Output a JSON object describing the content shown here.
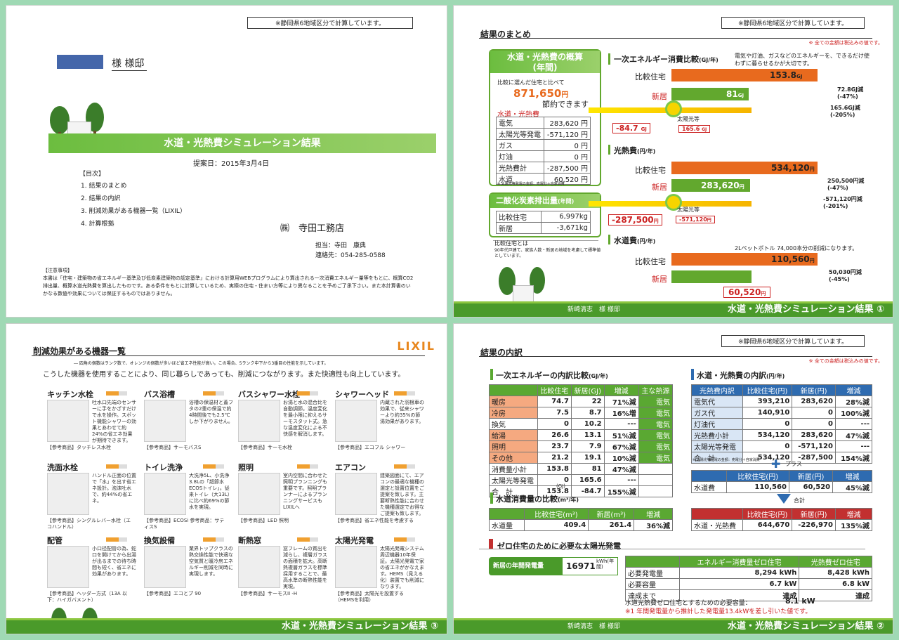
{
  "p1": {
    "note": "※静岡県6地域区分で計算しています。",
    "customer": "様 様邸",
    "banner": "水道・光熱費シミュレーション結果",
    "date": "提案日：2015年3月4日",
    "toc_title": "【目次】",
    "toc": [
      "1. 結果のまとめ",
      "2. 結果の内訳",
      "3. 削減効果がある機器一覧（LIXIL）",
      "4. 計算根拠"
    ],
    "company": "㈱　寺田工務店",
    "staff": "担当：寺田　康典",
    "contact": "連絡先：054-285-0588",
    "caution_title": "【注意事項】",
    "caution": "本書は「住宅・建築物の省エネルギー基準及び低炭素建築物の認定基準」における計算用WEBプログラムにより算出される一次消費エネルギー量等をもとに、概算CO2排出量、概算水道光熱費を算出したものです。ある条件をもとに計算しているため、実際の住宅・住まい方等により異なることを予めご了承下さい。また本計算書のいかなる数値や効果については保証するものではありません。"
  },
  "p2": {
    "note": "※静岡県6地域区分で計算しています。",
    "tax_note": "※ 全ての金額は税込みの値です。",
    "title": "結果のまとめ",
    "overview_title": "水道・光熱費の概算",
    "overview_sub": "(年間)",
    "compare_text": "比較に選んだ住宅と比べて",
    "saving": "871,650",
    "yen": "円",
    "saving_text": "節約できます",
    "cost_title": "水道・光熱費",
    "cost_rows": [
      [
        "電気",
        "283,620 円"
      ],
      [
        "太陽光等発電",
        "-571,120 円"
      ],
      [
        "ガス",
        "0 円"
      ],
      [
        "灯油",
        "0 円"
      ],
      [
        "光熱費計",
        "-287,500 円"
      ],
      [
        "水道",
        "60,520 円"
      ]
    ],
    "cost_note": "※ 太陽光等発電の金額：売電分＋自家消費",
    "co2_title": "二酸化炭素排出量",
    "co2_unit": "(年間)",
    "co2_rows": [
      [
        "比較住宅",
        "6,997kg"
      ],
      [
        "新居",
        "-3,671kg"
      ]
    ],
    "compare_house_title": "比較住宅とは",
    "compare_house_text": "90年代戸建て、家族人数・新居の地域を考慮して標準値としています。",
    "energy_title": "一次エネルギー消費比較",
    "energy_unit": "(GJ/年)",
    "energy_desc": "電気や灯油、ガスなどのエネルギーを、できるだけ使わずに暮らせるかが大切です。",
    "label_compare": "比較住宅",
    "label_new": "新居",
    "energy_compare": "153.8",
    "energy_new": "81",
    "gj": "GJ",
    "energy_diff1": "72.8GJ減",
    "energy_diff1_pct": "(-47%)",
    "energy_diff2": "165.6GJ減",
    "energy_diff2_pct": "(-205%)",
    "energy_net": "-84.7",
    "solar_label": "太陽光等",
    "solar_energy": "165.6",
    "utility_title": "光熱費",
    "utility_unit": "(円/年)",
    "utility_compare": "534,120",
    "utility_new": "283,620",
    "utility_diff1": "250,500円減",
    "utility_diff1_pct": "(-47%)",
    "utility_diff2": "-571,120円減",
    "utility_diff2_pct": "(-201%)",
    "utility_net": "-287,500",
    "solar_utility": "-571,120",
    "water_title": "水道費",
    "water_unit": "(円/年)",
    "water_desc": "2Lペットボトル 74,000本分の削減になります。",
    "water_compare": "110,560",
    "water_new": "60,520",
    "water_diff": "50,030円減",
    "water_diff_pct": "(-45%)",
    "footer_name": "新崎清志　様 様邸",
    "footer_title": "水道・光熱費シミュレーション結果 ①"
  },
  "p3": {
    "title": "削減効果がある機器一覧",
    "brand": "LIXIL",
    "subtitle": "― 四角の個数はランク数で、オレンジの個数が多いほど省エネ性能が高い。この場合、5ランク中下から3番目の性能を示しています。",
    "lead": "こうした機器を使用することにより、同じ暮らしであっても、削減につながります。また快適性も向上しています。",
    "items": [
      {
        "t": "キッチン水栓",
        "d": "吐水口先端のセンサーに手をかざすだけで水を操作。スポット機能シャワーの効果とあわせて約24%の省エネ効果が期待できます。",
        "r": "【参考商品】タッチレス水栓"
      },
      {
        "t": "バス浴槽",
        "d": "浴槽の保温材と蓋フタの2重の保温で約4時間後でも2.5℃しか下がりません。",
        "r": "【参考商品】サーモバスS"
      },
      {
        "t": "バスシャワー水栓",
        "d": "お湯と水の混合比を自動調節。温度変化を最小限に抑えるサーモスタット式。急な温度変化による不快感を解消します。",
        "r": "【参考商品】サーモ水栓"
      },
      {
        "t": "シャワーヘッド",
        "d": "内蔵された羽根車の効果で、従来シャワーより約35%の節湯効果があります。",
        "r": "【参考商品】エコフル シャワー"
      },
      {
        "t": "洗面水栓",
        "d": "ハンドル正面の位置で「水」を出す省エネ設計。泡沫吐水で、約44%の省エネ。",
        "r": "【参考商品】シングルレバー水栓（エコハンドル）"
      },
      {
        "t": "トイレ洗浄",
        "d": "大洗浄5L、小洗浄3.8Lの「超節水ECOSトイレ」。従来トイレ（大13L）に比べ約69%の節水を実現。",
        "r": "【参考商品】ECOSi 参考商品：サティスS"
      },
      {
        "t": "照明",
        "d": "室内空間に合わせた照明プランニングも重要です。照明プランナーによるプランニングサービスもLIXILへ",
        "r": "【参考商品】LED 照明"
      },
      {
        "t": "エアコン",
        "d": "建築図面にて、エアコンの最適な機種の選定と設置位置をご提案を致します。主要断熱性能に合わせた機種選定でお得なご提案も致します。",
        "r": "【参考商品】省エネ性能を考慮する"
      },
      {
        "t": "配管",
        "d": "小口径配管の為、蛇口を開けてから出湯が出るまでの待ち時間も短く、省エネに効果があります。",
        "r": "【参考商品】ヘッダー方式（13A 以下：ハイガバメント）"
      },
      {
        "t": "換気設備",
        "d": "業界トップクラスの熱交換性能で快適な空気質と暖冷房エネルギー削減を同時に実現します。",
        "r": "【参考商品】エコとプ 90"
      },
      {
        "t": "断熱窓",
        "d": "窓フレームの質出を減らし、複層ガラスの面積を拡大。高断熱複層ガラスを標準採用することで、最高水準の断熱性能を実現。",
        "r": "【参考商品】サーモスII -H"
      },
      {
        "t": "太陽光発電",
        "d": "太陽光発電システム周辺機器10年保証。太陽光発電で家の省エネがかなえます。HEMS（見える化）装置でも削減になります。",
        "r": "【参考商品】太陽光を設置する（HEMSを利用）"
      }
    ],
    "footer_title": "水道・光熱費シミュレーション結果 ③"
  },
  "p4": {
    "note": "※静岡県6地域区分で計算しています。",
    "tax_note": "※ 全ての金額は税込みの値です。",
    "title": "結果の内訳",
    "energy_title": "一次エネルギーの内訳比較",
    "energy_unit": "(GJ/年)",
    "energy_headers": [
      "",
      "比較住宅",
      "新居(GJ)",
      "増減",
      "主な熱源"
    ],
    "energy_rows": [
      [
        "暖房",
        "74.7",
        "22",
        "71%減",
        "電気"
      ],
      [
        "冷房",
        "7.5",
        "8.7",
        "16%増",
        "電気"
      ],
      [
        "換気",
        "0",
        "10.2",
        "---",
        "電気"
      ],
      [
        "給湯",
        "26.6",
        "13.1",
        "51%減",
        "電気"
      ],
      [
        "照明",
        "23.7",
        "7.9",
        "67%減",
        "電気"
      ],
      [
        "その他",
        "21.2",
        "19.1",
        "10%減",
        "電気"
      ],
      [
        "消費量小計",
        "153.8",
        "81",
        "47%減",
        ""
      ],
      [
        "太陽光等発電",
        "0",
        "165.6",
        "---",
        ""
      ],
      [
        "合　計",
        "153.8",
        "-84.7",
        "155%減",
        ""
      ]
    ],
    "energy_total_unit": "(GJ)",
    "water_title": "水道消費量の比較",
    "water_unit": "(m³/年)",
    "water_headers": [
      "",
      "比較住宅(m³)",
      "新居(m³)",
      "増減"
    ],
    "water_row": [
      "水道量",
      "409.4",
      "261.4",
      "36%減"
    ],
    "utility_title": "水道・光熱費の内訳",
    "utility_unit": "(円/年)",
    "utility_headers": [
      "光熱費内訳",
      "比較住宅(円)",
      "新居(円)",
      "増減"
    ],
    "utility_rows": [
      [
        "電気代",
        "393,210",
        "283,620",
        "28%減"
      ],
      [
        "ガス代",
        "140,910",
        "0",
        "100%減"
      ],
      [
        "灯油代",
        "0",
        "0",
        "---"
      ],
      [
        "光熱費小計",
        "534,120",
        "283,620",
        "47%減"
      ],
      [
        "太陽光等発電",
        "0",
        "-571,120",
        "---"
      ],
      [
        "合　計",
        "534,120",
        "-287,500",
        "154%減"
      ]
    ],
    "utility_note": "※ 太陽光等発電の金額：売電分＋自家消費",
    "plus": "プラス",
    "wf_headers": [
      "",
      "比較住宅(円)",
      "新居(円)",
      "増減"
    ],
    "wf_row": [
      "水道費",
      "110,560",
      "60,520",
      "45%減"
    ],
    "total_label": "合計",
    "total_headers": [
      "",
      "比較住宅(円)",
      "新居(円)",
      "増減"
    ],
    "total_row": [
      "水道・光熱費",
      "644,670",
      "-226,970",
      "135%減"
    ],
    "zero_title": "ゼロ住宅のために必要な太陽光発電",
    "gen_label": "新居の年間発電量",
    "gen_value": "16971",
    "gen_unit": "kWh(年間)",
    "zero_headers": [
      "",
      "エネルギー消費量ゼロ住宅",
      "光熱費ゼロ住宅"
    ],
    "zero_rows": [
      [
        "必要発電量",
        "8,294 kWh",
        "8,428 kWh"
      ],
      [
        "必要容量",
        "6.7 kW",
        "6.8 kW"
      ],
      [
        "達成まで",
        "達成",
        "達成"
      ]
    ],
    "zero_req_label": "水道光熱費ゼロ住宅とするための必要容量：",
    "zero_req_value": "8.1 kW",
    "zero_footnote": "※1 年間発電量から推計した発電量13.4kWを差し引いた値です。",
    "footer_name": "新崎清志　様 様邸",
    "footer_title": "水道・光熱費シミュレーション結果 ②"
  },
  "colors": {
    "green": "#5aa832",
    "orange": "#e86a1e",
    "blue": "#2e6bb0",
    "red": "#c23030"
  }
}
